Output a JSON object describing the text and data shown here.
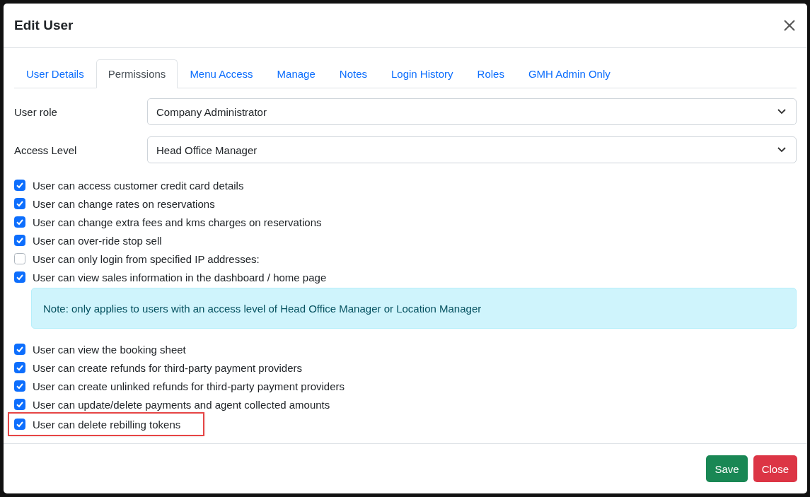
{
  "dialog": {
    "title": "Edit User"
  },
  "tabs": [
    {
      "label": "User Details",
      "selected": false
    },
    {
      "label": "Permissions",
      "selected": true
    },
    {
      "label": "Menu Access",
      "selected": false
    },
    {
      "label": "Manage",
      "selected": false
    },
    {
      "label": "Notes",
      "selected": false
    },
    {
      "label": "Login History",
      "selected": false
    },
    {
      "label": "Roles",
      "selected": false
    },
    {
      "label": "GMH Admin Only",
      "selected": false
    }
  ],
  "fields": [
    {
      "label": "User role",
      "value": "Company Administrator"
    },
    {
      "label": "Access Level",
      "value": "Head Office Manager"
    }
  ],
  "permissions": [
    {
      "kind": "checkbox",
      "label": "User can access customer credit card details",
      "checked": true,
      "highlighted": false
    },
    {
      "kind": "checkbox",
      "label": "User can change rates on reservations",
      "checked": true,
      "highlighted": false
    },
    {
      "kind": "checkbox",
      "label": "User can change extra fees and kms charges on reservations",
      "checked": true,
      "highlighted": false
    },
    {
      "kind": "checkbox",
      "label": "User can over-ride stop sell",
      "checked": true,
      "highlighted": false
    },
    {
      "kind": "checkbox",
      "label": "User can only login from specified IP addresses:",
      "checked": false,
      "highlighted": false
    },
    {
      "kind": "checkbox",
      "label": "User can view sales information in the dashboard / home page",
      "checked": true,
      "highlighted": false
    },
    {
      "kind": "note",
      "label": "Note: only applies to users with an access level of Head Office Manager or Location Manager"
    },
    {
      "kind": "checkbox",
      "label": "User can view the booking sheet",
      "checked": true,
      "highlighted": false
    },
    {
      "kind": "checkbox",
      "label": "User can create refunds for third-party payment providers",
      "checked": true,
      "highlighted": false
    },
    {
      "kind": "checkbox",
      "label": "User can create unlinked refunds for third-party payment providers",
      "checked": true,
      "highlighted": false
    },
    {
      "kind": "checkbox",
      "label": "User can update/delete payments and agent collected amounts",
      "checked": true,
      "highlighted": false
    },
    {
      "kind": "checkbox",
      "label": "User can delete rebilling tokens",
      "checked": true,
      "highlighted": true
    }
  ],
  "buttons": [
    {
      "label": "Save",
      "kind": "primary"
    },
    {
      "label": "Close",
      "kind": "danger"
    }
  ]
}
